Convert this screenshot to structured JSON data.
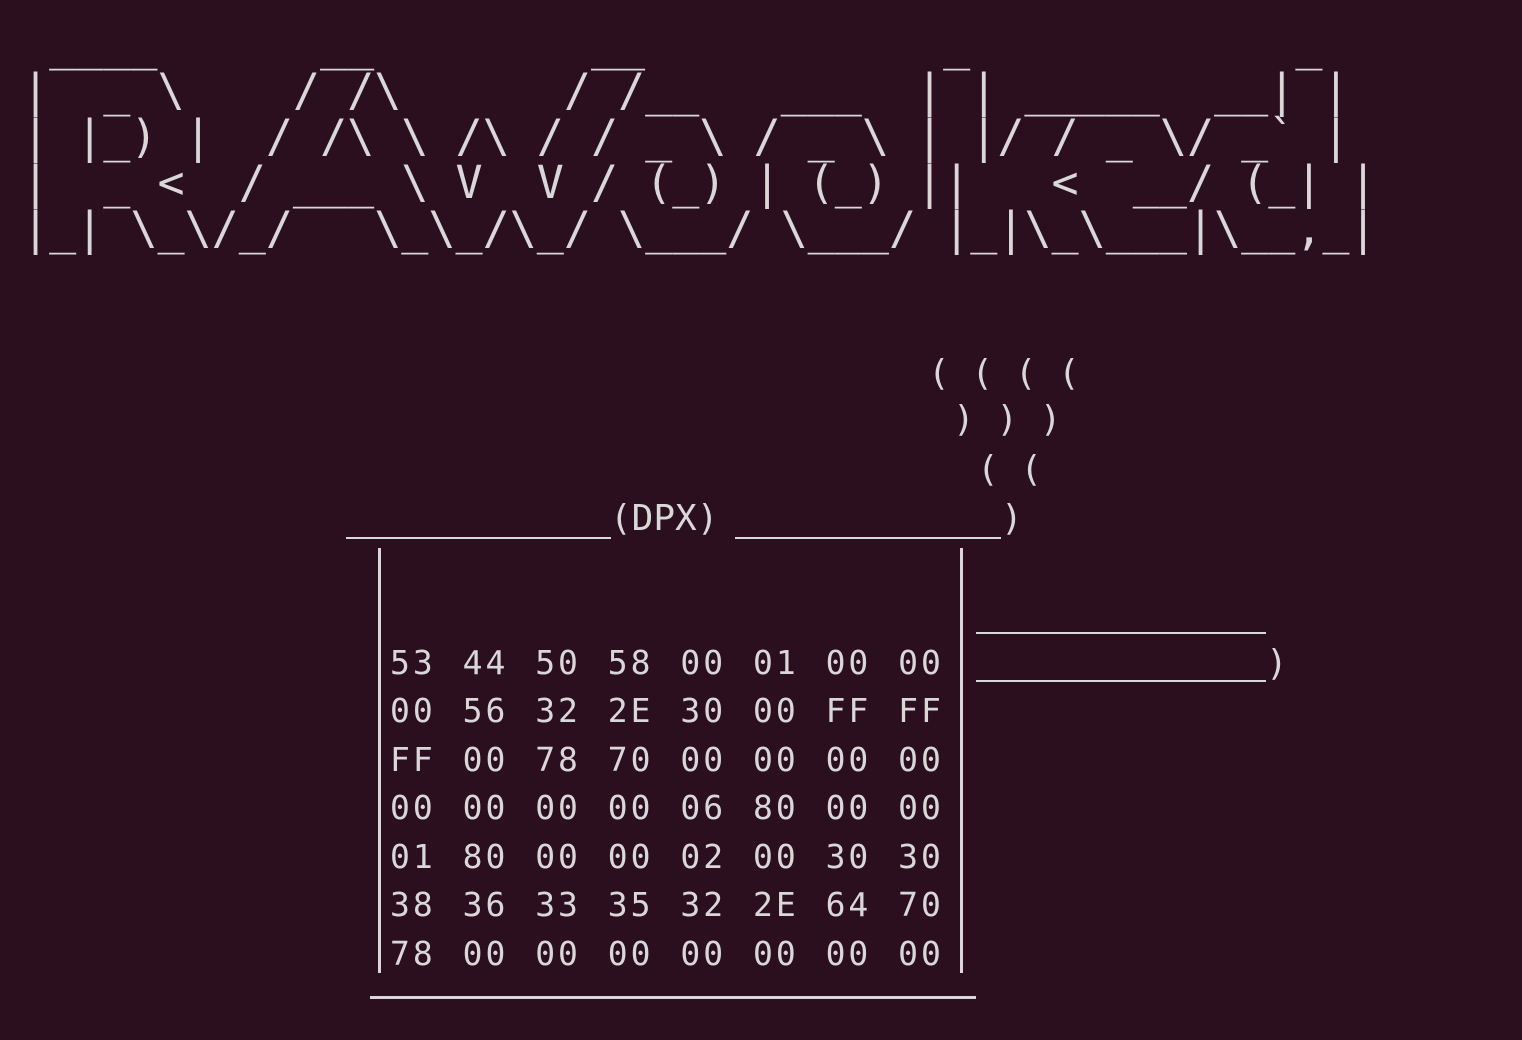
{
  "terminal": {
    "background": "#2c0f1f",
    "foreground": "#d8d8d8",
    "banner_lines": [
      " ____      __        __           _            _ ",
      "|  _ \\    / /\\      / /__   ___  | | _____  __| |",
      "| |_) |  / /\\ \\ /\\ / / _ \\ / _ \\ | |/ / _ \\/ _` |",
      "|  _ <  / ___ \\ V  V / (_) | (_) ||   <  __/ (_| |",
      "|_| \\_\\/_/   \\_\\_/\\_/ \\___/ \\___/ |_|\\_\\___|\\__,_|"
    ],
    "steam": {
      "line1": "( ( ( (",
      "line2": ") ) )",
      "line3": "( (",
      "line4": ")"
    },
    "pot": {
      "label": "(DPX)",
      "handle_end": ")",
      "hex_rows": [
        [
          "53",
          "44",
          "50",
          "58",
          "00",
          "01",
          "00",
          "00"
        ],
        [
          "00",
          "56",
          "32",
          "2E",
          "30",
          "00",
          "FF",
          "FF"
        ],
        [
          "FF",
          "00",
          "78",
          "70",
          "00",
          "00",
          "00",
          "00"
        ],
        [
          "00",
          "00",
          "00",
          "00",
          "06",
          "80",
          "00",
          "00"
        ],
        [
          "01",
          "80",
          "00",
          "00",
          "02",
          "00",
          "30",
          "30"
        ],
        [
          "38",
          "36",
          "33",
          "35",
          "32",
          "2E",
          "64",
          "70"
        ],
        [
          "78",
          "00",
          "00",
          "00",
          "00",
          "00",
          "00",
          "00"
        ]
      ]
    }
  }
}
